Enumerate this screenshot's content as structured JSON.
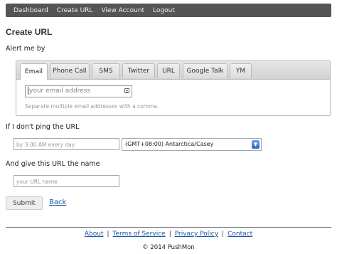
{
  "nav": {
    "items": [
      "Dashboard",
      "Create URL",
      "View Account",
      "Logout"
    ]
  },
  "page": {
    "title": "Create URL"
  },
  "alert": {
    "label": "Alert me by",
    "tabs": [
      "Email",
      "Phone Call",
      "SMS",
      "Twitter",
      "URL",
      "Google Talk",
      "YM"
    ],
    "active_tab": "Email",
    "email_placeholder": "your email address",
    "help_text": "Separate multiple email addresses with a comma."
  },
  "ping": {
    "label": "If I don't ping the URL",
    "time_placeholder": "by 3:00 AM every day",
    "timezone_value": "(GMT+08:00) Antarctica/Casey"
  },
  "name": {
    "label": "And give this URL the name",
    "placeholder": "your URL name"
  },
  "actions": {
    "submit_label": "Submit",
    "back_label": "Back"
  },
  "footer": {
    "links": [
      "About",
      "Terms of Service",
      "Privacy Policy",
      "Contact"
    ],
    "copyright": "© 2014 PushMon"
  },
  "colors": {
    "nav_bg": "#555555",
    "link": "#1a55a0"
  }
}
